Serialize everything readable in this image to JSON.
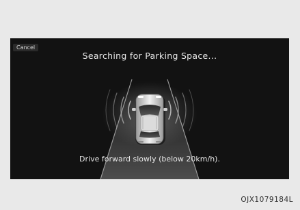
{
  "screen": {
    "cancel_label": "Cancel",
    "title": "Searching for Parking Space...",
    "message": "Drive forward slowly (below 20km/h)."
  },
  "caption": "OJX1079184L",
  "icons": {
    "vehicle": "car-top-view-icon",
    "sensor_waves": "ultrasonic-wave-icon"
  },
  "colors": {
    "screen_background": "#121212",
    "text": "#e8e8e8",
    "page_background": "#e9e9e9"
  }
}
